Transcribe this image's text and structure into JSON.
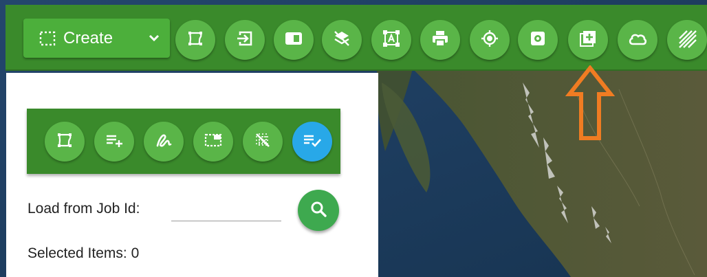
{
  "toolbar": {
    "create_label": "Create",
    "buttons": [
      {
        "icon": "lasso-select-icon"
      },
      {
        "icon": "import-icon"
      },
      {
        "icon": "panel-toggle-icon"
      },
      {
        "icon": "layers-off-icon"
      },
      {
        "icon": "text-box-icon"
      },
      {
        "icon": "printer-icon"
      },
      {
        "icon": "locate-icon"
      },
      {
        "icon": "settings-icon"
      },
      {
        "icon": "add-to-list-icon"
      },
      {
        "icon": "cloud-icon"
      },
      {
        "icon": "hatch-pattern-icon"
      }
    ]
  },
  "panel": {
    "tools": [
      {
        "icon": "lasso-select-icon"
      },
      {
        "icon": "add-to-list-icon"
      },
      {
        "icon": "draw-freehand-icon"
      },
      {
        "icon": "select-rectangle-icon"
      },
      {
        "icon": "clear-selection-icon"
      },
      {
        "icon": "checklist-icon"
      }
    ],
    "job_label": "Load from Job Id:",
    "job_value": "",
    "selected_text": "Selected Items: 0"
  },
  "colors": {
    "toolbar_green": "#3a8a2b",
    "button_green": "#5ab548",
    "active_blue": "#28a8e8",
    "annotation_orange": "#f07c22"
  }
}
